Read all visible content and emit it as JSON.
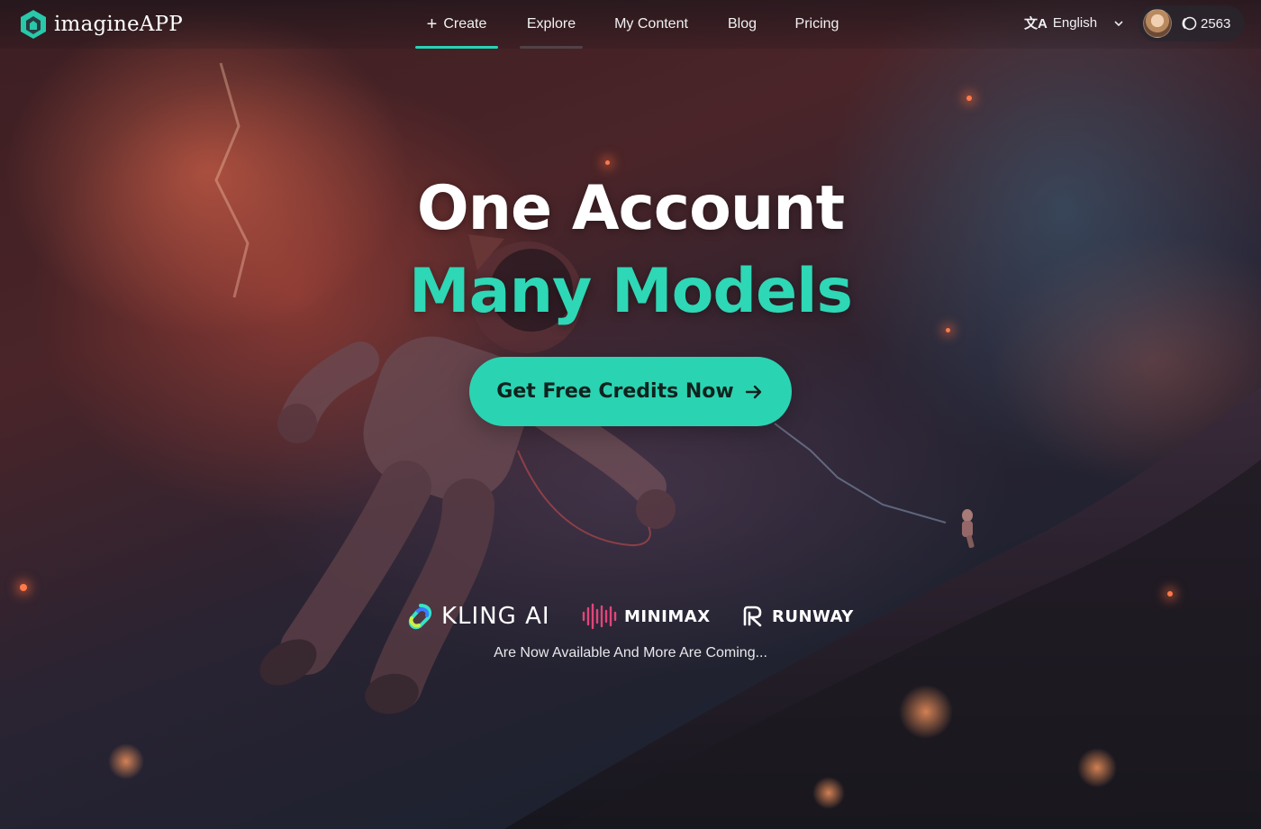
{
  "brand": {
    "name": "imagineAPP",
    "logo_icon": "house-hexagon-logo"
  },
  "nav": {
    "items": [
      {
        "label": "Create",
        "icon": "plus-icon",
        "active": true
      },
      {
        "label": "Explore"
      },
      {
        "label": "My Content"
      },
      {
        "label": "Blog"
      },
      {
        "label": "Pricing"
      }
    ]
  },
  "language": {
    "label": "English",
    "icon": "translate-icon"
  },
  "account": {
    "credits": "2563",
    "credit_icon": "coin-icon"
  },
  "hero": {
    "title_line1": "One Account",
    "title_line2": "Many Models",
    "cta_label": "Get Free Credits Now"
  },
  "partners": {
    "items": [
      {
        "name": "KLING AI",
        "icon": "kling-logo"
      },
      {
        "name": "MINIMAX",
        "icon": "waveform-logo"
      },
      {
        "name": "RUNWAY",
        "icon": "runway-logo"
      }
    ],
    "tagline": "Are Now Available And More Are Coming..."
  },
  "colors": {
    "accent": "#2ad4b2",
    "accent_text": "#2ed7b5",
    "cta_text": "#10221e"
  }
}
